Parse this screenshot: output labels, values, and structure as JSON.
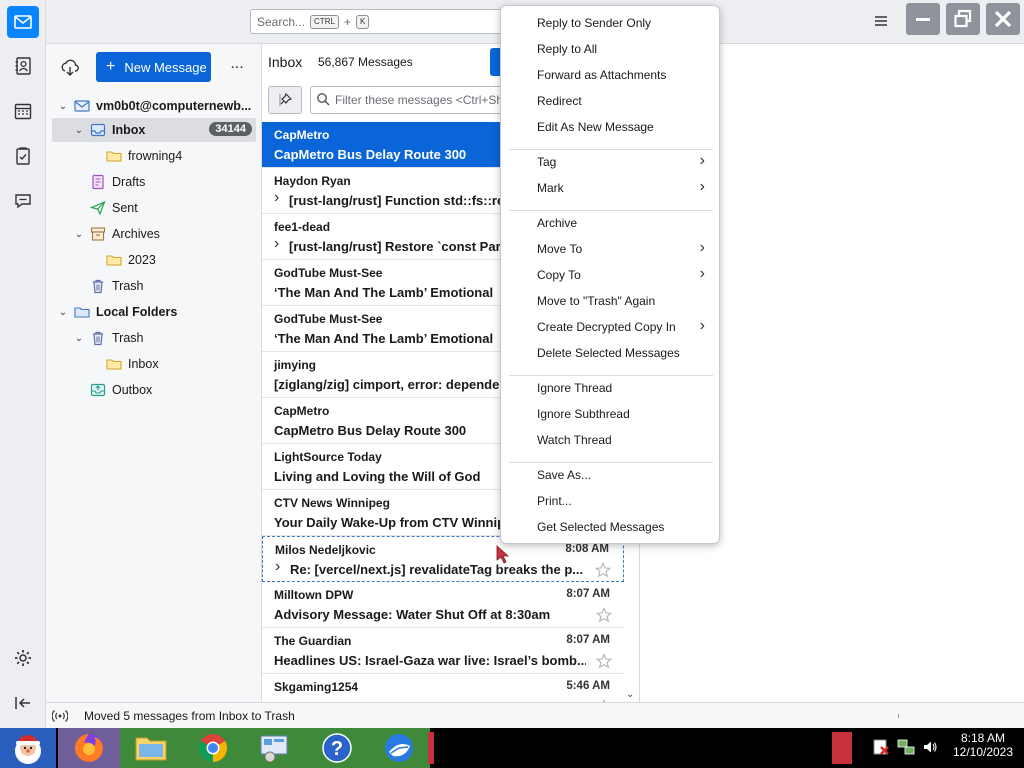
{
  "search": {
    "placeholder": "Search...",
    "key1": "CTRL",
    "plus": "+",
    "key2": "K"
  },
  "folder_pane": {
    "new_message_label": "New Message",
    "more_label": "...",
    "account": "vm0b0t@computernewb...",
    "folders": [
      {
        "label": "Inbox",
        "badge": "34144"
      },
      {
        "label": "frowning4"
      },
      {
        "label": "Drafts"
      },
      {
        "label": "Sent"
      },
      {
        "label": "Archives"
      },
      {
        "label": "2023"
      },
      {
        "label": "Trash"
      },
      {
        "label": "Local Folders"
      },
      {
        "label": "Trash"
      },
      {
        "label": "Inbox"
      },
      {
        "label": "Outbox"
      }
    ]
  },
  "message_list": {
    "folder_title": "Inbox",
    "message_count": "56,867 Messages",
    "filter_placeholder": "Filter these messages <Ctrl+Shift+K>",
    "messages": [
      {
        "sender": "CapMetro",
        "subject": "CapMetro Bus Delay Route 300",
        "time": ""
      },
      {
        "sender": "Haydon Ryan",
        "subject": "[rust-lang/rust] Function std::fs::read",
        "time": ""
      },
      {
        "sender": "fee1-dead",
        "subject": "[rust-lang/rust] Restore `const Parti",
        "time": ""
      },
      {
        "sender": "GodTube Must-See",
        "subject": "‘The Man And The Lamb’ Emotional",
        "time": ""
      },
      {
        "sender": "GodTube Must-See",
        "subject": "‘The Man And The Lamb’ Emotional",
        "time": ""
      },
      {
        "sender": "jimying",
        "subject": "[ziglang/zig] cimport, error: depende",
        "time": ""
      },
      {
        "sender": "CapMetro",
        "subject": "CapMetro Bus Delay Route 300",
        "time": ""
      },
      {
        "sender": "LightSource Today",
        "subject": "Living and Loving the Will of God",
        "time": ""
      },
      {
        "sender": "CTV News Winnipeg",
        "subject": "Your Daily Wake-Up from CTV Winnip",
        "time": ""
      },
      {
        "sender": "Milos Nedeljkovic",
        "subject": "Re: [vercel/next.js] revalidateTag breaks the p...",
        "time": "8:08 AM"
      },
      {
        "sender": "Milltown DPW",
        "subject": "Advisory Message: Water Shut Off at 8:30am",
        "time": "8:07 AM"
      },
      {
        "sender": "The Guardian",
        "subject": "Headlines US: Israel-Gaza war live: Israel’s bomb...",
        "time": "8:07 AM"
      },
      {
        "sender": "Skgaming1254",
        "subject": "",
        "time": "5:46 AM"
      }
    ]
  },
  "context_menu": {
    "items": [
      {
        "label": "Reply to Sender Only"
      },
      {
        "label": "Reply to All"
      },
      {
        "label": "Forward as Attachments"
      },
      {
        "label": "Redirect"
      },
      {
        "label": "Edit As New Message"
      },
      {
        "label": "Tag"
      },
      {
        "label": "Mark"
      },
      {
        "label": "Archive"
      },
      {
        "label": "Move To"
      },
      {
        "label": "Copy To"
      },
      {
        "label": "Move to \"Trash\" Again"
      },
      {
        "label": "Create Decrypted Copy In"
      },
      {
        "label": "Delete Selected Messages"
      },
      {
        "label": "Ignore Thread"
      },
      {
        "label": "Ignore Subthread"
      },
      {
        "label": "Watch Thread"
      },
      {
        "label": "Save As..."
      },
      {
        "label": "Print..."
      },
      {
        "label": "Get Selected Messages"
      }
    ],
    "submenu_arrow": "›"
  },
  "status_bar": {
    "text": "Moved 5 messages from Inbox to Trash"
  },
  "taskbar": {
    "time": "8:18 AM",
    "date": "12/10/2023"
  },
  "colors": {
    "accent": "#0a66d8",
    "mail_space": "#0a84ff",
    "selected_row": "#0a66d8"
  }
}
